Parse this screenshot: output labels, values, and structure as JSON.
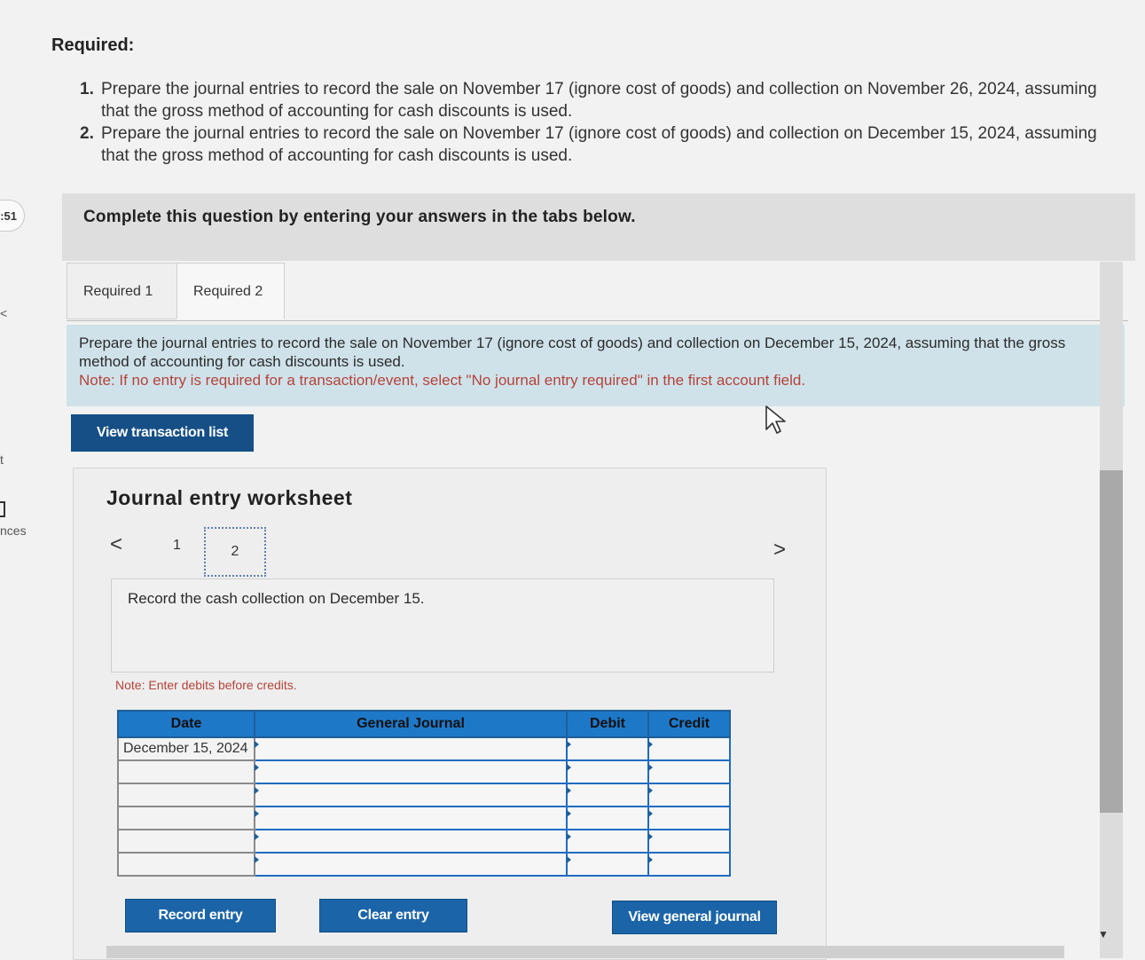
{
  "side": {
    "timer": ":51",
    "fragment_nces": "nces",
    "fragment_t": "t",
    "fragment_lt": "<"
  },
  "header": {
    "required_title": "Required:",
    "items": [
      {
        "num": "1.",
        "text": "Prepare the journal entries to record the sale on November 17 (ignore cost of goods) and collection on November 26, 2024, assuming that the gross method of accounting for cash discounts is used."
      },
      {
        "num": "2.",
        "text": "Prepare the journal entries to record the sale on November 17 (ignore cost of goods) and collection on December 15, 2024, assuming that the gross method of accounting for cash discounts is used."
      }
    ]
  },
  "banner": {
    "text": "Complete this question by entering your answers in the tabs below."
  },
  "tabs": [
    {
      "label": "Required 1",
      "active": false
    },
    {
      "label": "Required 2",
      "active": true
    }
  ],
  "instruction": {
    "text": "Prepare the journal entries to record the sale on November 17 (ignore cost of goods) and collection on December 15, 2024, assuming that the gross method of accounting for cash discounts is used.",
    "note": "Note: If no entry is required for a transaction/event, select \"No journal entry required\" in the first account field."
  },
  "buttons": {
    "view_transaction_list": "View transaction list",
    "record_entry": "Record entry",
    "clear_entry": "Clear entry",
    "view_general_journal": "View general journal"
  },
  "worksheet": {
    "title": "Journal entry worksheet",
    "pager": {
      "prev": "<",
      "next": ">",
      "pages": [
        "1",
        "2"
      ],
      "current": "2"
    },
    "description": "Record the cash collection on December 15.",
    "note": "Note: Enter debits before credits."
  },
  "journal_table": {
    "headers": {
      "date": "Date",
      "general_journal": "General Journal",
      "debit": "Debit",
      "credit": "Credit"
    },
    "rows": [
      {
        "date": "December 15, 2024",
        "account": "",
        "debit": "",
        "credit": ""
      },
      {
        "date": "",
        "account": "",
        "debit": "",
        "credit": ""
      },
      {
        "date": "",
        "account": "",
        "debit": "",
        "credit": ""
      },
      {
        "date": "",
        "account": "",
        "debit": "",
        "credit": ""
      },
      {
        "date": "",
        "account": "",
        "debit": "",
        "credit": ""
      },
      {
        "date": "",
        "account": "",
        "debit": "",
        "credit": ""
      }
    ]
  },
  "colors": {
    "button_blue": "#1b64a8",
    "header_blue": "#1e78c8",
    "note_red": "#b5433a",
    "instruction_bg": "#cfe2ea"
  },
  "icons": [
    "cursor-pointer-icon",
    "chevron-left-icon",
    "chevron-right-icon",
    "scroll-down-arrow-icon"
  ]
}
